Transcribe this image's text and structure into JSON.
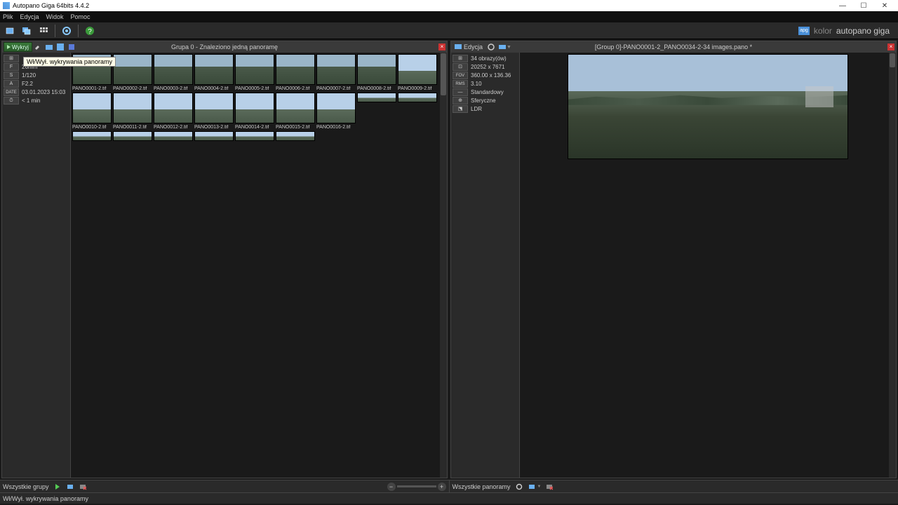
{
  "title": "Autopano Giga 64bits 4.4.2",
  "menu": {
    "file": "Plik",
    "edit": "Edycja",
    "view": "Widok",
    "help": "Pomoc"
  },
  "brand": {
    "prefix": "kolor",
    "name": "autopano giga",
    "logo": "apg"
  },
  "left_panel": {
    "detect_label": "Wykryj",
    "title": "Grupa 0 - Znaleziono jedną panoramę",
    "tooltip": "Wł/Wył. wykrywania panoramy",
    "meta": {
      "count_label": "⊞",
      "count_val": "",
      "f_label": "F",
      "f_val": "26mm",
      "s_label": "S",
      "s_val": "1/120",
      "a_label": "A",
      "a_val": "F2.2",
      "date_label": "DATE",
      "date_val": "03.01.2023 15:03",
      "time_label": "⏱",
      "time_val": "< 1 min"
    },
    "thumbs": [
      "PANO0001-2.tif",
      "PANO0002-2.tif",
      "PANO0003-2.tif",
      "PANO0004-2.tif",
      "PANO0005-2.tif",
      "PANO0006-2.tif",
      "PANO0007-2.tif",
      "PANO0008-2.tif",
      "PANO0009-2.tif",
      "PANO0010-2.tif",
      "PANO0011-2.tif",
      "PANO0012-2.tif",
      "PANO0013-2.tif",
      "PANO0014-2.tif",
      "PANO0015-2.tif",
      "PANO0016-2.tif"
    ]
  },
  "right_panel": {
    "edit_label": "Edycja",
    "title": "[Group 0]-PANO0001-2_PANO0034-2-34 images.pano *",
    "meta": {
      "count_label": "⊞",
      "count_val": "34 obrazy(ów)",
      "dim_label": "⊡",
      "dim_val": "20252 x 7671",
      "fov_label": "FOV",
      "fov_val": "360.00 x 136.36",
      "rms_label": "RMS",
      "rms_val": "3.10",
      "proj_label": "—",
      "proj_val": "Standardowy",
      "sph_label": "⊕",
      "sph_val": "Sferyczne",
      "ldr_label": "⬔",
      "ldr_val": "LDR"
    }
  },
  "footer": {
    "left_label": "Wszystkie grupy",
    "right_label": "Wszystkie panoramy"
  },
  "statusbar": "Wł/Wył. wykrywania panoramy"
}
